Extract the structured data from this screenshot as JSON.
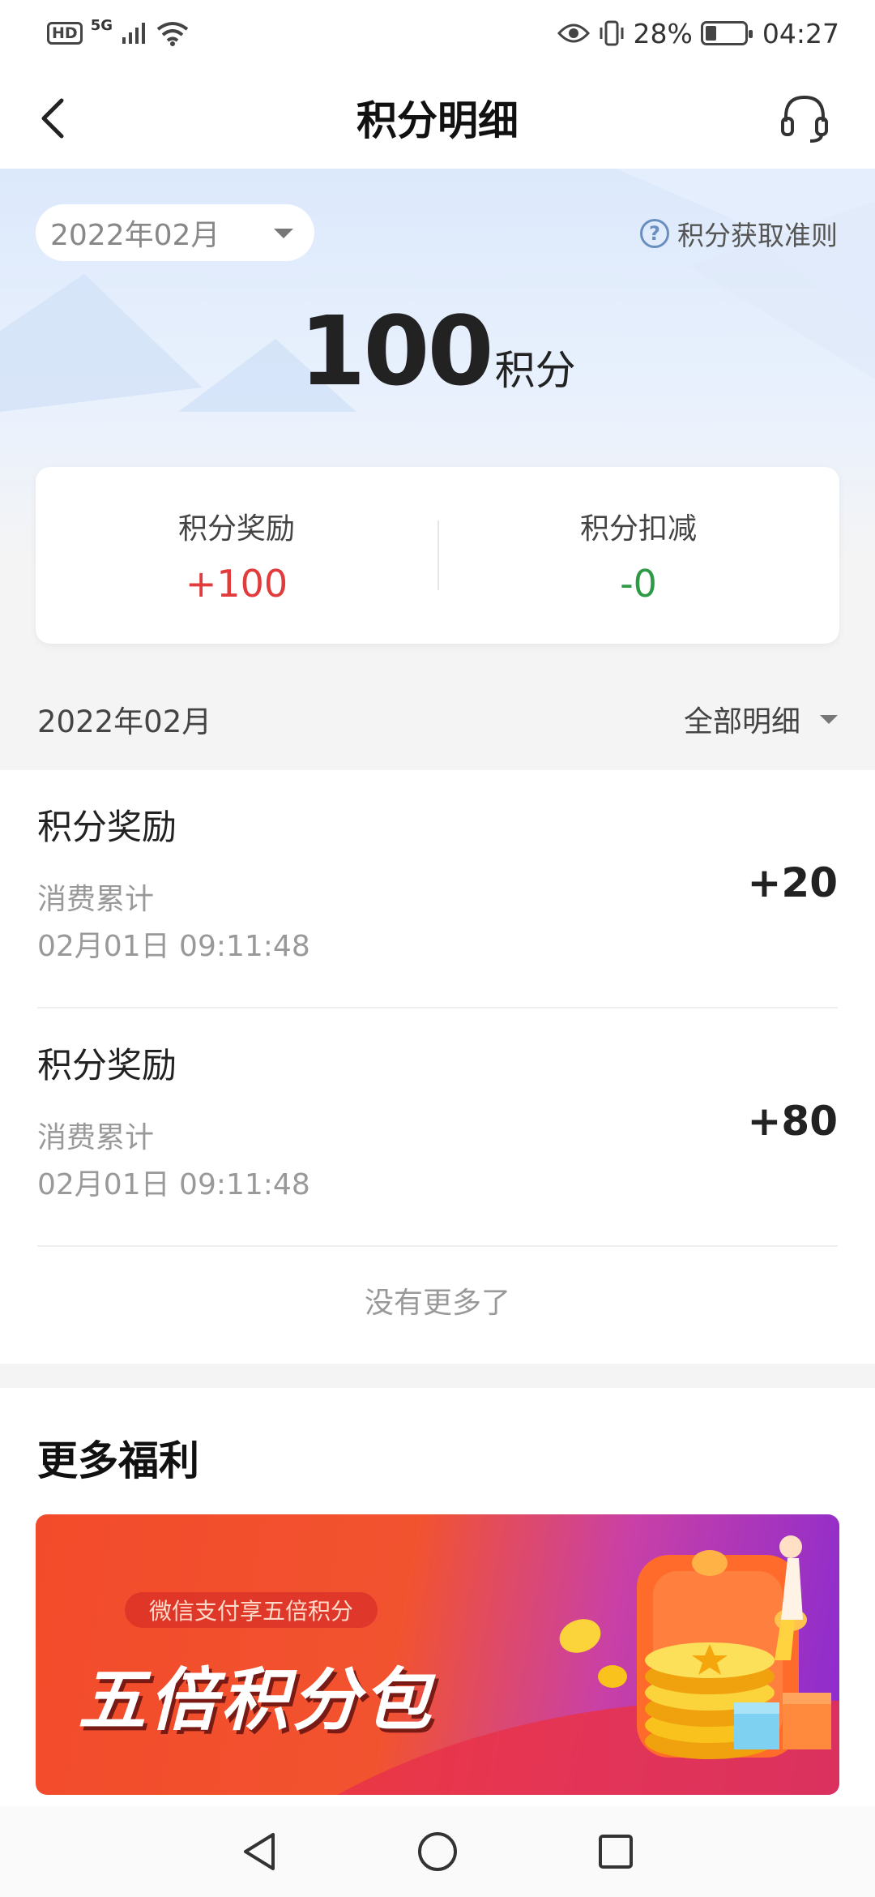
{
  "status_bar": {
    "hd": "HD",
    "network": "5G",
    "battery_text": "28%",
    "battery_level": 0.28,
    "time": "04:27"
  },
  "header": {
    "title": "积分明细"
  },
  "hero": {
    "month_selector": "2022年02月",
    "rules_link": "积分获取准则",
    "balance_value": "100",
    "balance_unit": "积分"
  },
  "summary": {
    "reward_label": "积分奖励",
    "reward_value": "+100",
    "deduct_label": "积分扣减",
    "deduct_value": "-0"
  },
  "filter": {
    "month": "2022年02月",
    "type": "全部明细"
  },
  "records": [
    {
      "title": "积分奖励",
      "desc": "消费累计",
      "time": "02月01日 09:11:48",
      "amount": "+20"
    },
    {
      "title": "积分奖励",
      "desc": "消费累计",
      "time": "02月01日 09:11:48",
      "amount": "+80"
    }
  ],
  "no_more": "没有更多了",
  "benefits": {
    "title": "更多福利",
    "banner_tag": "微信支付享五倍积分",
    "banner_headline": "五倍积分包"
  },
  "colors": {
    "reward": "#e23b3b",
    "deduct": "#2f9a45",
    "banner_start": "#f24b2b",
    "banner_end": "#8a2bd0"
  },
  "icons": {
    "back": "chevron-left-icon",
    "support": "headset-icon",
    "rules": "question-circle-icon",
    "nav_back": "triangle-back-icon",
    "nav_home": "circle-home-icon",
    "nav_recent": "square-recent-icon"
  }
}
